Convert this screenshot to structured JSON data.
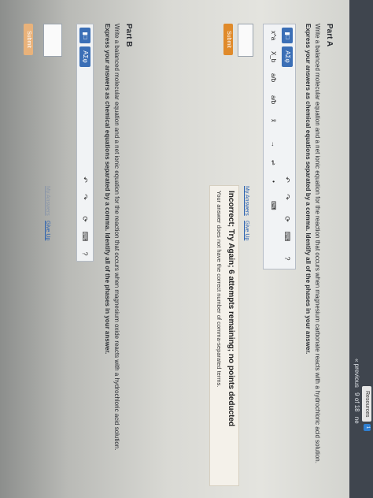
{
  "header": {
    "resources_label": "Resources",
    "resources_badge": "1",
    "previous_label": "« previous",
    "page_indicator": "9 of 18",
    "next_label": "ne"
  },
  "partA": {
    "title": "Part A",
    "question": "Write a balanced molecular equation and a net ionic equation for the reaction that occurs when magnesium carbonate reacts with a hydrochloric acid solution.",
    "instruction": "Express your answers as chemical equations separated by a comma. Identify all of the phases in your answer.",
    "toolbar": {
      "template_button": "▮□",
      "greek_button": "ΑΣφ",
      "superscript": "x^a",
      "subscript": "X_b",
      "fraction1": "a/b",
      "fraction2": "a/b",
      "overline": "x̄",
      "arrow": "→",
      "equals": "⇌",
      "bullet": "•",
      "keyboard": "⌨",
      "help": "?"
    },
    "submit_label": "Submit",
    "my_answers_label": "My Answers",
    "give_up_label": "Give Up",
    "feedback": {
      "title": "Incorrect; Try Again; 6 attempts remaining; no points deducted",
      "message": "Your answer does not have the correct number of comma-separated terms."
    }
  },
  "partB": {
    "title": "Part B",
    "question": "Write a balanced molecular equation and a net ionic equation for the reaction that occurs when magnesium oxide reacts with a hydrochloric acid solution.",
    "instruction": "Express your answers as chemical equations separated by a comma. Identify all of the phases in your answer.",
    "toolbar": {
      "template_button": "▮□",
      "greek_button": "ΑΣφ",
      "help": "?"
    },
    "submit_label": "Submit",
    "my_answers_label": "My Answers",
    "give_up_label": "Give Up"
  }
}
